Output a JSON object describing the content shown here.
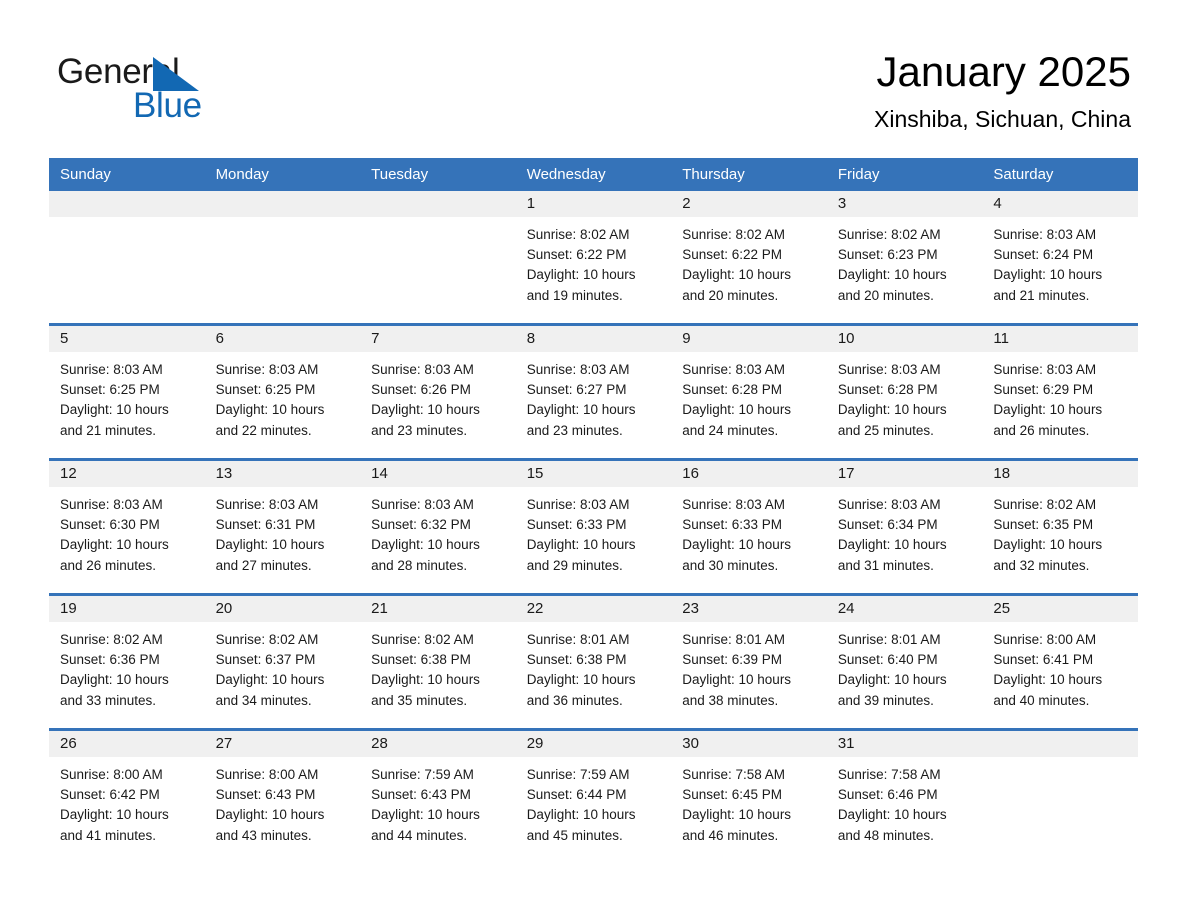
{
  "brand": {
    "name_part1": "General",
    "name_part2": "Blue",
    "logo_icon": "triangle-flag-icon",
    "accent_color": "#1268b3"
  },
  "header": {
    "month_title": "January 2025",
    "location": "Xinshiba, Sichuan, China"
  },
  "colors": {
    "header_row_bg": "#3573b9",
    "header_row_text": "#ffffff",
    "daynum_band_bg": "#f0f0f0",
    "cell_bg": "#ffffff",
    "separator": "#3573b9"
  },
  "weekday_headers": [
    "Sunday",
    "Monday",
    "Tuesday",
    "Wednesday",
    "Thursday",
    "Friday",
    "Saturday"
  ],
  "weeks": [
    [
      {
        "day": "",
        "empty": true,
        "sunrise": "",
        "sunset": "",
        "daylight_line1": "",
        "daylight_line2": ""
      },
      {
        "day": "",
        "empty": true,
        "sunrise": "",
        "sunset": "",
        "daylight_line1": "",
        "daylight_line2": ""
      },
      {
        "day": "",
        "empty": true,
        "sunrise": "",
        "sunset": "",
        "daylight_line1": "",
        "daylight_line2": ""
      },
      {
        "day": "1",
        "empty": false,
        "sunrise": "Sunrise: 8:02 AM",
        "sunset": "Sunset: 6:22 PM",
        "daylight_line1": "Daylight: 10 hours",
        "daylight_line2": "and 19 minutes."
      },
      {
        "day": "2",
        "empty": false,
        "sunrise": "Sunrise: 8:02 AM",
        "sunset": "Sunset: 6:22 PM",
        "daylight_line1": "Daylight: 10 hours",
        "daylight_line2": "and 20 minutes."
      },
      {
        "day": "3",
        "empty": false,
        "sunrise": "Sunrise: 8:02 AM",
        "sunset": "Sunset: 6:23 PM",
        "daylight_line1": "Daylight: 10 hours",
        "daylight_line2": "and 20 minutes."
      },
      {
        "day": "4",
        "empty": false,
        "sunrise": "Sunrise: 8:03 AM",
        "sunset": "Sunset: 6:24 PM",
        "daylight_line1": "Daylight: 10 hours",
        "daylight_line2": "and 21 minutes."
      }
    ],
    [
      {
        "day": "5",
        "empty": false,
        "sunrise": "Sunrise: 8:03 AM",
        "sunset": "Sunset: 6:25 PM",
        "daylight_line1": "Daylight: 10 hours",
        "daylight_line2": "and 21 minutes."
      },
      {
        "day": "6",
        "empty": false,
        "sunrise": "Sunrise: 8:03 AM",
        "sunset": "Sunset: 6:25 PM",
        "daylight_line1": "Daylight: 10 hours",
        "daylight_line2": "and 22 minutes."
      },
      {
        "day": "7",
        "empty": false,
        "sunrise": "Sunrise: 8:03 AM",
        "sunset": "Sunset: 6:26 PM",
        "daylight_line1": "Daylight: 10 hours",
        "daylight_line2": "and 23 minutes."
      },
      {
        "day": "8",
        "empty": false,
        "sunrise": "Sunrise: 8:03 AM",
        "sunset": "Sunset: 6:27 PM",
        "daylight_line1": "Daylight: 10 hours",
        "daylight_line2": "and 23 minutes."
      },
      {
        "day": "9",
        "empty": false,
        "sunrise": "Sunrise: 8:03 AM",
        "sunset": "Sunset: 6:28 PM",
        "daylight_line1": "Daylight: 10 hours",
        "daylight_line2": "and 24 minutes."
      },
      {
        "day": "10",
        "empty": false,
        "sunrise": "Sunrise: 8:03 AM",
        "sunset": "Sunset: 6:28 PM",
        "daylight_line1": "Daylight: 10 hours",
        "daylight_line2": "and 25 minutes."
      },
      {
        "day": "11",
        "empty": false,
        "sunrise": "Sunrise: 8:03 AM",
        "sunset": "Sunset: 6:29 PM",
        "daylight_line1": "Daylight: 10 hours",
        "daylight_line2": "and 26 minutes."
      }
    ],
    [
      {
        "day": "12",
        "empty": false,
        "sunrise": "Sunrise: 8:03 AM",
        "sunset": "Sunset: 6:30 PM",
        "daylight_line1": "Daylight: 10 hours",
        "daylight_line2": "and 26 minutes."
      },
      {
        "day": "13",
        "empty": false,
        "sunrise": "Sunrise: 8:03 AM",
        "sunset": "Sunset: 6:31 PM",
        "daylight_line1": "Daylight: 10 hours",
        "daylight_line2": "and 27 minutes."
      },
      {
        "day": "14",
        "empty": false,
        "sunrise": "Sunrise: 8:03 AM",
        "sunset": "Sunset: 6:32 PM",
        "daylight_line1": "Daylight: 10 hours",
        "daylight_line2": "and 28 minutes."
      },
      {
        "day": "15",
        "empty": false,
        "sunrise": "Sunrise: 8:03 AM",
        "sunset": "Sunset: 6:33 PM",
        "daylight_line1": "Daylight: 10 hours",
        "daylight_line2": "and 29 minutes."
      },
      {
        "day": "16",
        "empty": false,
        "sunrise": "Sunrise: 8:03 AM",
        "sunset": "Sunset: 6:33 PM",
        "daylight_line1": "Daylight: 10 hours",
        "daylight_line2": "and 30 minutes."
      },
      {
        "day": "17",
        "empty": false,
        "sunrise": "Sunrise: 8:03 AM",
        "sunset": "Sunset: 6:34 PM",
        "daylight_line1": "Daylight: 10 hours",
        "daylight_line2": "and 31 minutes."
      },
      {
        "day": "18",
        "empty": false,
        "sunrise": "Sunrise: 8:02 AM",
        "sunset": "Sunset: 6:35 PM",
        "daylight_line1": "Daylight: 10 hours",
        "daylight_line2": "and 32 minutes."
      }
    ],
    [
      {
        "day": "19",
        "empty": false,
        "sunrise": "Sunrise: 8:02 AM",
        "sunset": "Sunset: 6:36 PM",
        "daylight_line1": "Daylight: 10 hours",
        "daylight_line2": "and 33 minutes."
      },
      {
        "day": "20",
        "empty": false,
        "sunrise": "Sunrise: 8:02 AM",
        "sunset": "Sunset: 6:37 PM",
        "daylight_line1": "Daylight: 10 hours",
        "daylight_line2": "and 34 minutes."
      },
      {
        "day": "21",
        "empty": false,
        "sunrise": "Sunrise: 8:02 AM",
        "sunset": "Sunset: 6:38 PM",
        "daylight_line1": "Daylight: 10 hours",
        "daylight_line2": "and 35 minutes."
      },
      {
        "day": "22",
        "empty": false,
        "sunrise": "Sunrise: 8:01 AM",
        "sunset": "Sunset: 6:38 PM",
        "daylight_line1": "Daylight: 10 hours",
        "daylight_line2": "and 36 minutes."
      },
      {
        "day": "23",
        "empty": false,
        "sunrise": "Sunrise: 8:01 AM",
        "sunset": "Sunset: 6:39 PM",
        "daylight_line1": "Daylight: 10 hours",
        "daylight_line2": "and 38 minutes."
      },
      {
        "day": "24",
        "empty": false,
        "sunrise": "Sunrise: 8:01 AM",
        "sunset": "Sunset: 6:40 PM",
        "daylight_line1": "Daylight: 10 hours",
        "daylight_line2": "and 39 minutes."
      },
      {
        "day": "25",
        "empty": false,
        "sunrise": "Sunrise: 8:00 AM",
        "sunset": "Sunset: 6:41 PM",
        "daylight_line1": "Daylight: 10 hours",
        "daylight_line2": "and 40 minutes."
      }
    ],
    [
      {
        "day": "26",
        "empty": false,
        "sunrise": "Sunrise: 8:00 AM",
        "sunset": "Sunset: 6:42 PM",
        "daylight_line1": "Daylight: 10 hours",
        "daylight_line2": "and 41 minutes."
      },
      {
        "day": "27",
        "empty": false,
        "sunrise": "Sunrise: 8:00 AM",
        "sunset": "Sunset: 6:43 PM",
        "daylight_line1": "Daylight: 10 hours",
        "daylight_line2": "and 43 minutes."
      },
      {
        "day": "28",
        "empty": false,
        "sunrise": "Sunrise: 7:59 AM",
        "sunset": "Sunset: 6:43 PM",
        "daylight_line1": "Daylight: 10 hours",
        "daylight_line2": "and 44 minutes."
      },
      {
        "day": "29",
        "empty": false,
        "sunrise": "Sunrise: 7:59 AM",
        "sunset": "Sunset: 6:44 PM",
        "daylight_line1": "Daylight: 10 hours",
        "daylight_line2": "and 45 minutes."
      },
      {
        "day": "30",
        "empty": false,
        "sunrise": "Sunrise: 7:58 AM",
        "sunset": "Sunset: 6:45 PM",
        "daylight_line1": "Daylight: 10 hours",
        "daylight_line2": "and 46 minutes."
      },
      {
        "day": "31",
        "empty": false,
        "sunrise": "Sunrise: 7:58 AM",
        "sunset": "Sunset: 6:46 PM",
        "daylight_line1": "Daylight: 10 hours",
        "daylight_line2": "and 48 minutes."
      },
      {
        "day": "",
        "empty": true,
        "sunrise": "",
        "sunset": "",
        "daylight_line1": "",
        "daylight_line2": ""
      }
    ]
  ]
}
